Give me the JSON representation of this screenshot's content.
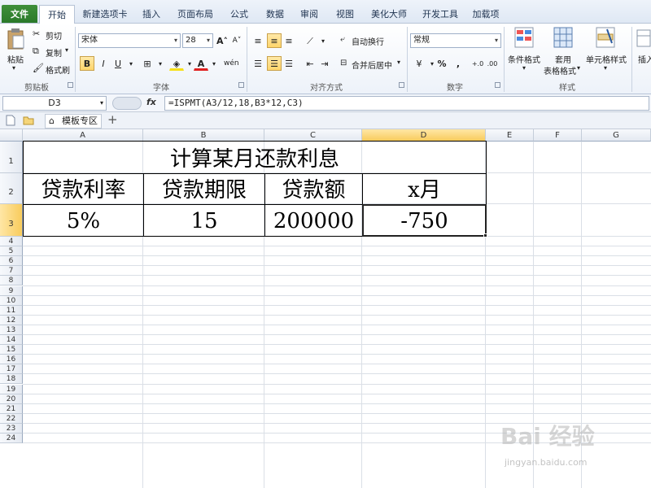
{
  "tabs": [
    "文件",
    "开始",
    "新建选项卡",
    "插入",
    "页面布局",
    "公式",
    "数据",
    "审阅",
    "视图",
    "美化大师",
    "开发工具",
    "加载项"
  ],
  "ribbon": {
    "clipboard": {
      "paste": "粘贴",
      "cut": "剪切",
      "copy": "复制",
      "format_painter": "格式刷",
      "label": "剪贴板"
    },
    "font": {
      "name": "宋体",
      "size": "28",
      "label": "字体"
    },
    "alignment": {
      "wrap": "自动换行",
      "merge": "合并后居中",
      "label": "对齐方式"
    },
    "number": {
      "format": "常规",
      "label": "数字"
    },
    "styles": {
      "conditional": "条件格式",
      "table": "套用",
      "table2": "表格格式",
      "cell": "单元格样式",
      "label": "样式"
    },
    "insert": "插入"
  },
  "formula_bar": {
    "name_box": "D3",
    "fx": "fx",
    "formula": "=ISPMT(A3/12,18,B3*12,C3)"
  },
  "sheet_tabs": {
    "template": "模板专区",
    "add": "+"
  },
  "grid": {
    "columns": [
      "A",
      "B",
      "C",
      "D",
      "E",
      "F",
      "G"
    ],
    "rows": [
      "1",
      "2",
      "3",
      "4",
      "5",
      "6",
      "7",
      "8",
      "9",
      "10",
      "11",
      "12",
      "13",
      "14",
      "15",
      "16",
      "17",
      "18",
      "19",
      "20",
      "21",
      "22",
      "23",
      "24"
    ],
    "title": "计算某月还款利息",
    "headers": [
      "贷款利率",
      "贷款期限",
      "贷款额",
      "x月"
    ],
    "values": [
      "5%",
      "15",
      "200000",
      "-750"
    ]
  },
  "watermark": {
    "logo": "Bai 经验",
    "url": "jingyan.baidu.com"
  }
}
